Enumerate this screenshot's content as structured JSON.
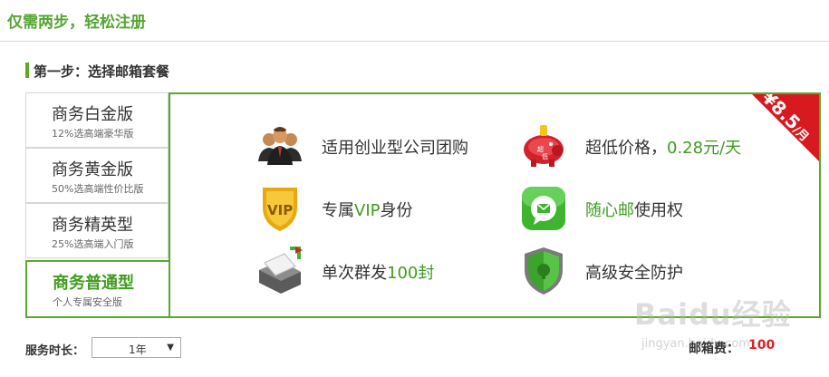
{
  "header": {
    "title": "仅需两步，轻松注册"
  },
  "step": {
    "title": "第一步：选择邮箱套餐"
  },
  "plans": [
    {
      "name": "商务白金版",
      "desc": "12%选高端豪华版"
    },
    {
      "name": "商务黄金版",
      "desc": "50%选高端性价比版"
    },
    {
      "name": "商务精英型",
      "desc": "25%选高端入门版"
    },
    {
      "name": "商务普通型",
      "desc": "个人专属安全版"
    }
  ],
  "ribbon": {
    "price": "¥8.5",
    "unit": "/月"
  },
  "features": [
    {
      "icon": "group-icon",
      "text_pre": "适用创业型公司团购",
      "text_hl": "",
      "text_post": ""
    },
    {
      "icon": "piggy-bank-icon",
      "text_pre": "超低价格，",
      "text_hl": "0.28元/天",
      "text_post": ""
    },
    {
      "icon": "vip-shield-icon",
      "text_pre": "专属",
      "text_hl": "VIP",
      "text_post": "身份"
    },
    {
      "icon": "message-icon",
      "text_pre": "",
      "text_hl": "随心邮",
      "text_post": "使用权"
    },
    {
      "icon": "mail-send-icon",
      "text_pre": "单次群发",
      "text_hl": "100封",
      "text_post": ""
    },
    {
      "icon": "security-shield-icon",
      "text_pre": "高级安全防护",
      "text_hl": "",
      "text_post": ""
    }
  ],
  "footer": {
    "duration_label": "服务时长：",
    "duration_value": "1年",
    "fee_label": "邮箱费：",
    "fee_value": "100"
  },
  "watermark": {
    "text": "Baidu经验",
    "sub": "jingyan.baidu.com"
  }
}
